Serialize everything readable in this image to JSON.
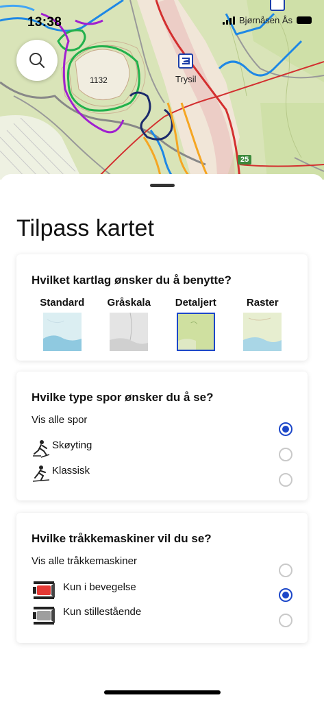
{
  "status_bar": {
    "time": "13:38",
    "place": "Bjørnåsen Ås"
  },
  "map": {
    "peak_elevation": "1132",
    "town_name": "Trysil",
    "road_number": "25"
  },
  "sheet": {
    "title": "Tilpass kartet",
    "map_layer_section": {
      "question": "Hvilket kartlag ønsker du å benytte?",
      "layers": [
        {
          "label": "Standard",
          "selected": false
        },
        {
          "label": "Gråskala",
          "selected": false
        },
        {
          "label": "Detaljert",
          "selected": true
        },
        {
          "label": "Raster",
          "selected": false
        }
      ]
    },
    "track_section": {
      "question": "Hvilke type spor ønsker du å se?",
      "options": [
        {
          "label": "Vis alle spor",
          "icon": "",
          "selected": true
        },
        {
          "label": "Skøyting",
          "icon": "skating-skier-icon",
          "selected": false
        },
        {
          "label": "Klassisk",
          "icon": "classic-skier-icon",
          "selected": false
        }
      ]
    },
    "groomer_section": {
      "question": "Hvilke tråkkemaskiner vil du se?",
      "options": [
        {
          "label": "Vis alle tråkkemaskiner",
          "icon": "",
          "selected": false
        },
        {
          "label": "Kun i bevegelse",
          "icon": "groomer-moving-icon",
          "selected": true
        },
        {
          "label": "Kun stillestående",
          "icon": "groomer-stationary-icon",
          "selected": false
        }
      ]
    }
  },
  "colors": {
    "accent": "#1c47c9",
    "trail_green": "#22b14c",
    "trail_purple": "#a020d0",
    "trail_blue": "#1e88e5",
    "trail_orange": "#f5a623",
    "road_red": "#d32f2f"
  }
}
